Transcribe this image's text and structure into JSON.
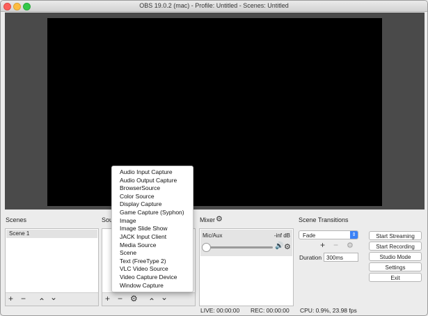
{
  "window": {
    "title": "OBS 19.0.2 (mac) - Profile: Untitled - Scenes: Untitled"
  },
  "scenes": {
    "label": "Scenes",
    "items": [
      "Scene 1"
    ],
    "toolbar": {
      "add": "+",
      "remove": "−",
      "up": "⌃",
      "down": "⌄"
    }
  },
  "sources": {
    "label": "Sou",
    "toolbar": {
      "add": "+",
      "remove": "−",
      "settings": "⚙",
      "up": "⌃",
      "down": "⌄"
    }
  },
  "source_menu": {
    "items": [
      "Audio Input Capture",
      "Audio Output Capture",
      "BrowserSource",
      "Color Source",
      "Display Capture",
      "Game Capture (Syphon)",
      "Image",
      "Image Slide Show",
      "JACK Input Client",
      "Media Source",
      "Scene",
      "Text (FreeType 2)",
      "VLC Video Source",
      "Video Capture Device",
      "Window Capture"
    ]
  },
  "mixer": {
    "label": "Mixer",
    "channel": {
      "name": "Mic/Aux",
      "level": "-inf dB"
    }
  },
  "transitions": {
    "label": "Scene Transitions",
    "selected": "Fade",
    "duration_label": "Duration",
    "duration_value": "300ms"
  },
  "controls": {
    "start_streaming": "Start Streaming",
    "start_recording": "Start Recording",
    "studio_mode": "Studio Mode",
    "settings": "Settings",
    "exit": "Exit"
  },
  "status": {
    "live": "LIVE: 00:00:00",
    "rec": "REC: 00:00:00",
    "cpu": "CPU: 0.9%, 23.98 fps"
  },
  "colors": {
    "preview_bg": "#4a4a4a",
    "canvas": "#000000",
    "accent": "#3b82f6"
  }
}
